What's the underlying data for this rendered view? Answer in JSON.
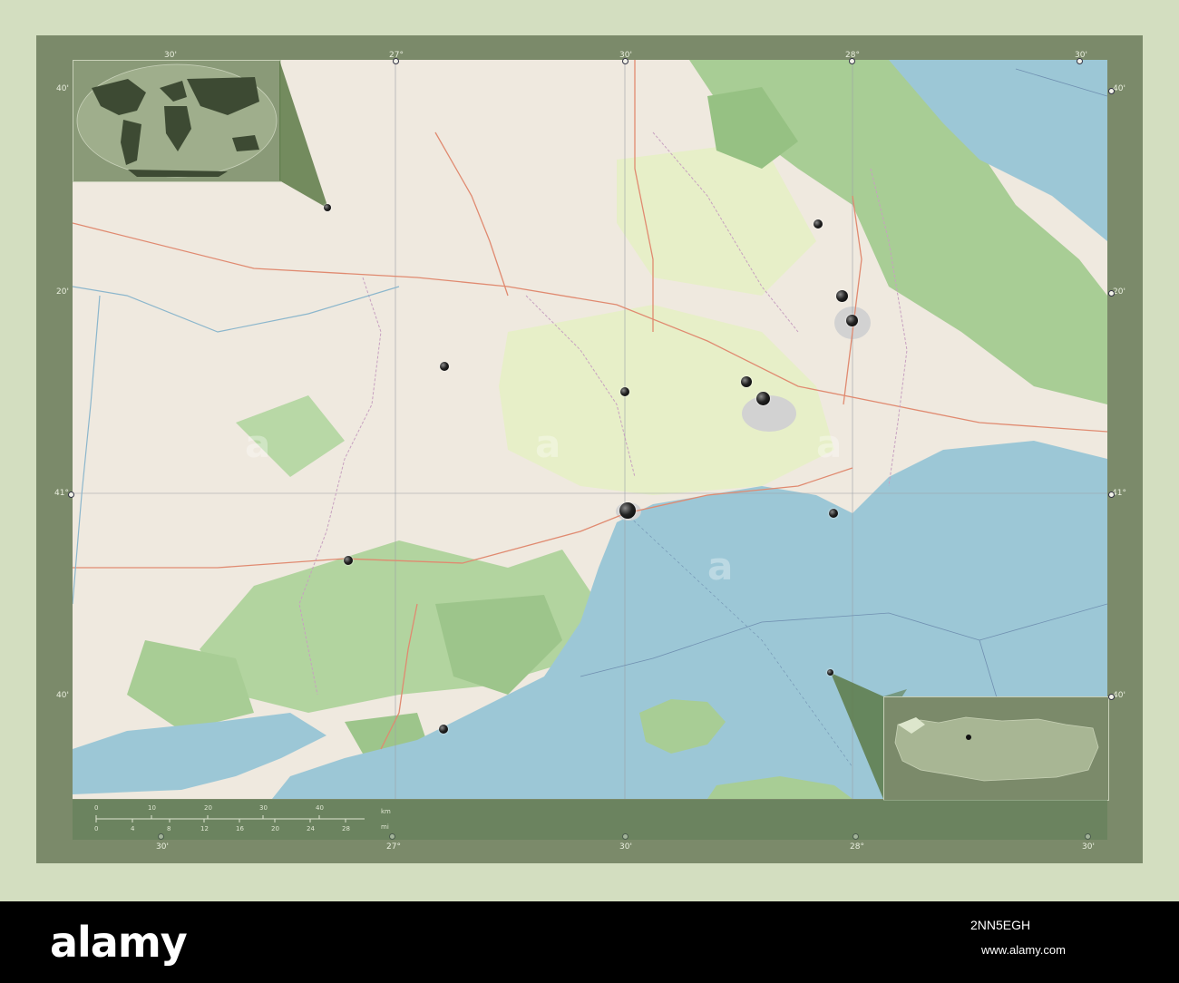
{
  "graticule": {
    "top_labels": [
      "30'",
      "27°",
      "30'",
      "28°",
      "30'"
    ],
    "bottom_labels": [
      "30'",
      "27°",
      "30'",
      "28°",
      "30'"
    ],
    "left_labels": [
      "40'",
      "20'",
      "41°",
      "40'"
    ],
    "right_labels": [
      "40'",
      "20'",
      "41°",
      "40'"
    ]
  },
  "scale": {
    "km_ticks": [
      "0",
      "10",
      "20",
      "30",
      "40"
    ],
    "km_unit": "km",
    "mi_ticks": [
      "0",
      "4",
      "8",
      "12",
      "16",
      "20",
      "24",
      "28"
    ],
    "mi_unit": "mi"
  },
  "watermark": {
    "logo": "alamy",
    "image_id": "2NN5EGH",
    "url": "www.alamy.com"
  },
  "colors": {
    "sea": "#9cc7d6",
    "land": "#efe9df",
    "forest": "#9dc58b",
    "farmland": "#e7efc8",
    "frame": "#7b8a6a",
    "page": "#d3dec0"
  }
}
